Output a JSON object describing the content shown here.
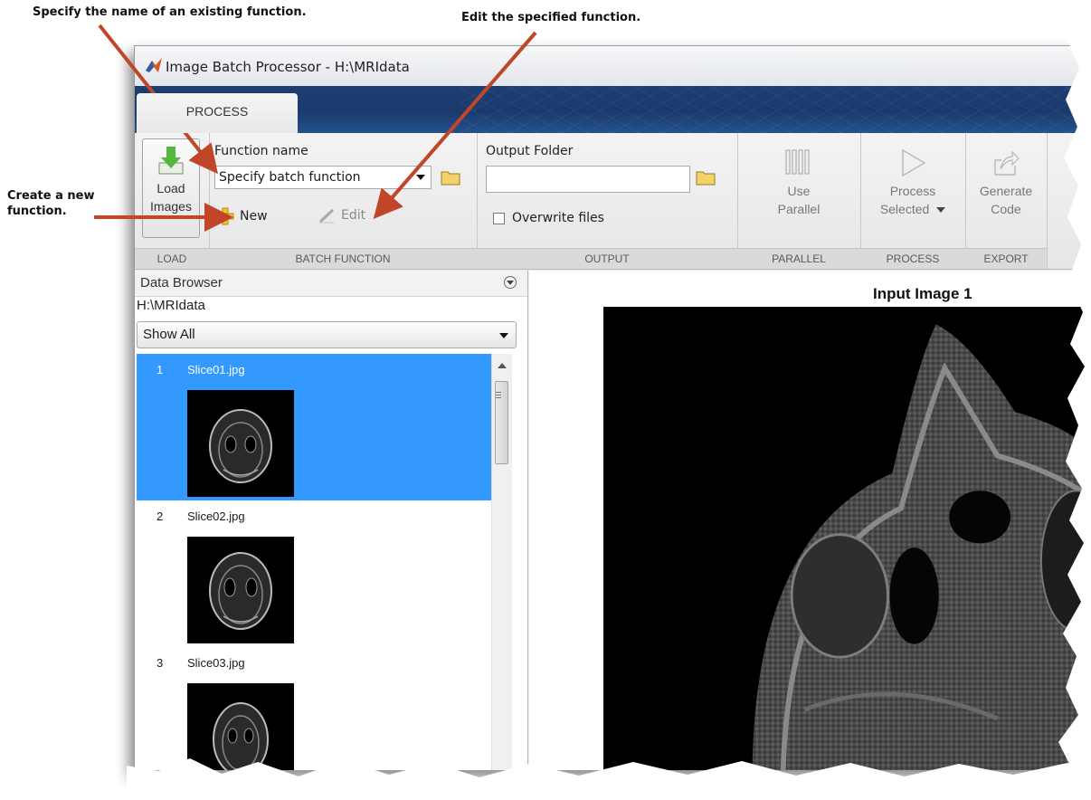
{
  "callouts": {
    "existing_function": "Specify the name of an existing function.",
    "edit_function": "Edit the specified function.",
    "new_function_line1": "Create a new",
    "new_function_line2": "function."
  },
  "window": {
    "title": "Image Batch Processor - H:\\MRIdata"
  },
  "tabs": [
    {
      "label": "PROCESS"
    }
  ],
  "toolstrip": {
    "load": {
      "label_line1": "Load",
      "label_line2": "Images",
      "section": "LOAD"
    },
    "batch_function": {
      "heading": "Function name",
      "value": "Specify batch function",
      "new_label": "New",
      "edit_label": "Edit",
      "section": "BATCH FUNCTION"
    },
    "output": {
      "heading": "Output Folder",
      "value": "",
      "overwrite_label": "Overwrite files",
      "overwrite_checked": false,
      "section": "OUTPUT"
    },
    "parallel": {
      "label_line1": "Use",
      "label_line2": "Parallel",
      "section": "PARALLEL"
    },
    "process": {
      "label_line1": "Process",
      "label_line2": "Selected",
      "section": "PROCESS"
    },
    "export": {
      "label_line1": "Generate",
      "label_line2": "Code",
      "section": "EXPORT"
    }
  },
  "data_browser": {
    "title": "Data Browser",
    "path": "H:\\MRIdata",
    "filter": "Show All",
    "items": [
      {
        "index": "1",
        "name": "Slice01.jpg",
        "selected": true
      },
      {
        "index": "2",
        "name": "Slice02.jpg",
        "selected": false
      },
      {
        "index": "3",
        "name": "Slice03.jpg",
        "selected": false
      }
    ]
  },
  "viewer": {
    "title": "Input Image 1"
  },
  "colors": {
    "arrow": "#c0462a",
    "selection": "#3399ff",
    "tab_band": "#1d3e73"
  }
}
